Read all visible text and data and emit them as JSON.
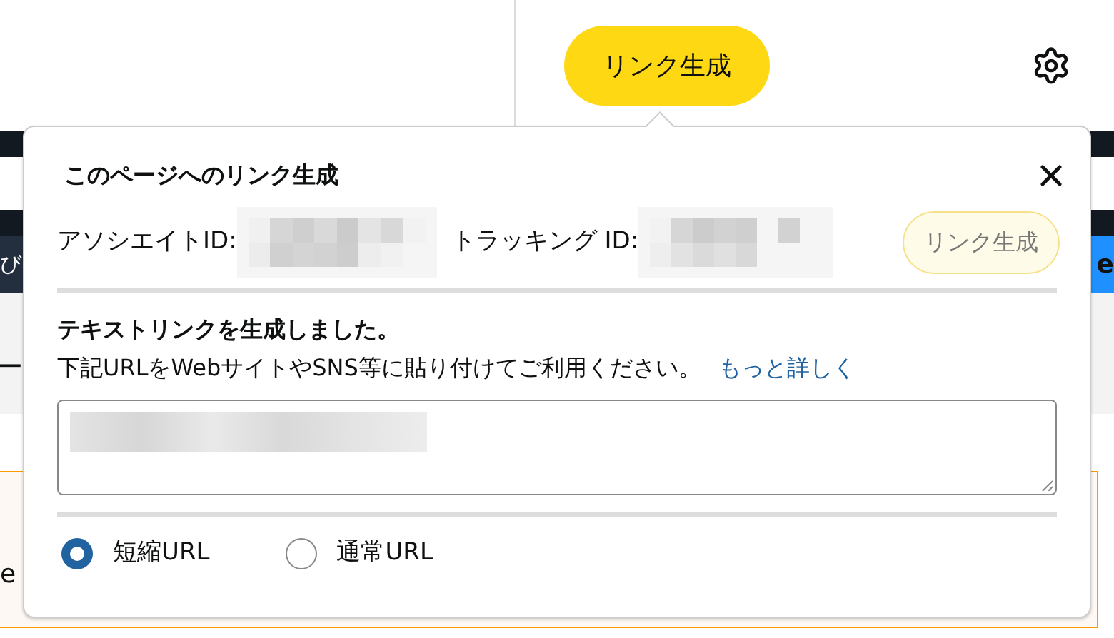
{
  "header": {
    "button": "リンク生成"
  },
  "page_behind": {
    "nav_text_left": "び",
    "nav_text_right": "e",
    "menu_text_left": "ー",
    "body_text_left": "e"
  },
  "popup": {
    "title": "このページへのリンク生成",
    "associate_label": "アソシエイトID:",
    "tracking_label": "トラッキング ID:",
    "generate_button": {
      "label": "リンク生成",
      "disabled": true
    },
    "heading": "テキストリンクを生成しました。",
    "message": "下記URLをWebサイトやSNS等に貼り付けてご利用ください。",
    "more_link": "もっと詳しく",
    "url_types": [
      {
        "label": "短縮URL",
        "selected": true
      },
      {
        "label": "通常URL",
        "selected": false
      }
    ]
  }
}
